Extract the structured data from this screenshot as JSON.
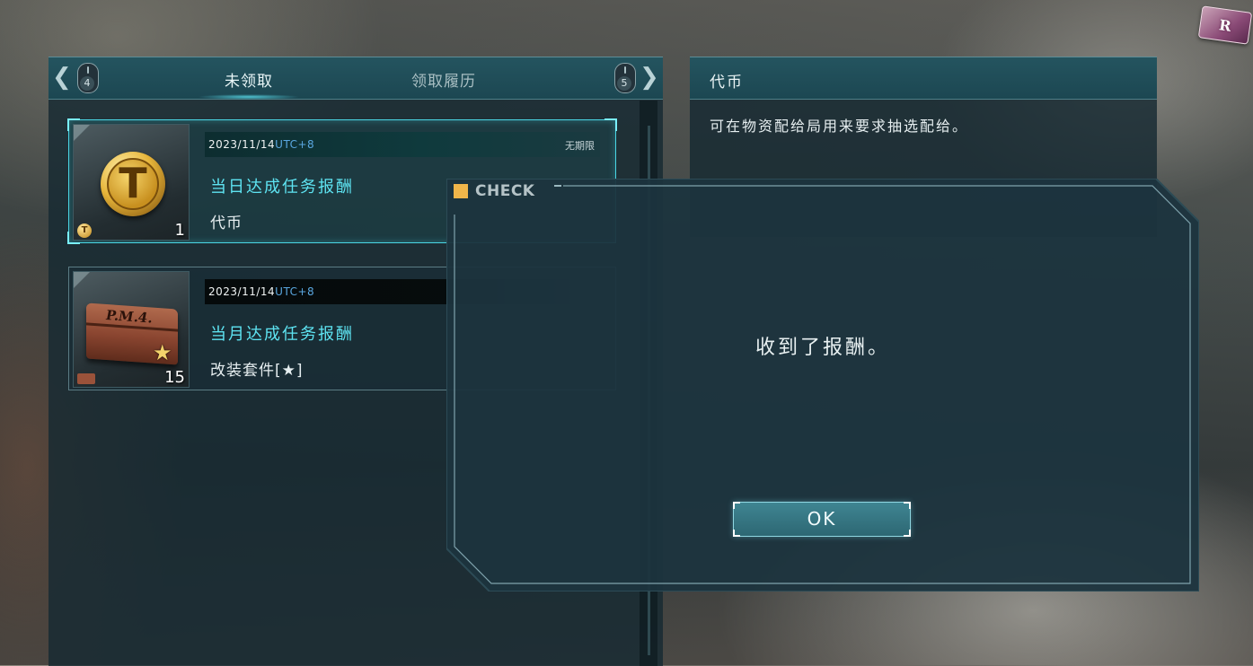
{
  "ticket": {
    "label": "R"
  },
  "tabs": {
    "left_key": "4",
    "right_key": "5",
    "unclaimed": "未领取",
    "history": "领取履历",
    "arrow_left": "❮",
    "arrow_right": "❯"
  },
  "rewards": [
    {
      "date": "2023/11/14",
      "tz": "UTC+8",
      "expire": "无期限",
      "name": "当日达成任务报酬",
      "item": "代币",
      "quantity": "1",
      "icon": "token-coin-icon",
      "icon_letter": "T",
      "selected": true
    },
    {
      "date": "2023/11/14",
      "tz": "UTC+8",
      "expire": "",
      "name": "当月达成任务报酬",
      "item": "改装套件[★]",
      "quantity": "15",
      "icon": "toolbox-icon",
      "icon_label": "P.M.4.",
      "selected": false
    }
  ],
  "detail": {
    "title": "代币",
    "description": "可在物资配给局用来要求抽选配给。"
  },
  "dialog": {
    "title": "CHECK",
    "message": "收到了报酬。",
    "ok_label": "OK"
  },
  "colors": {
    "accent_cyan": "#5ee4f2",
    "timezone_blue": "#5aa7e0",
    "dialog_title_square": "#f0b64a",
    "button_fill": "#3f8592"
  }
}
